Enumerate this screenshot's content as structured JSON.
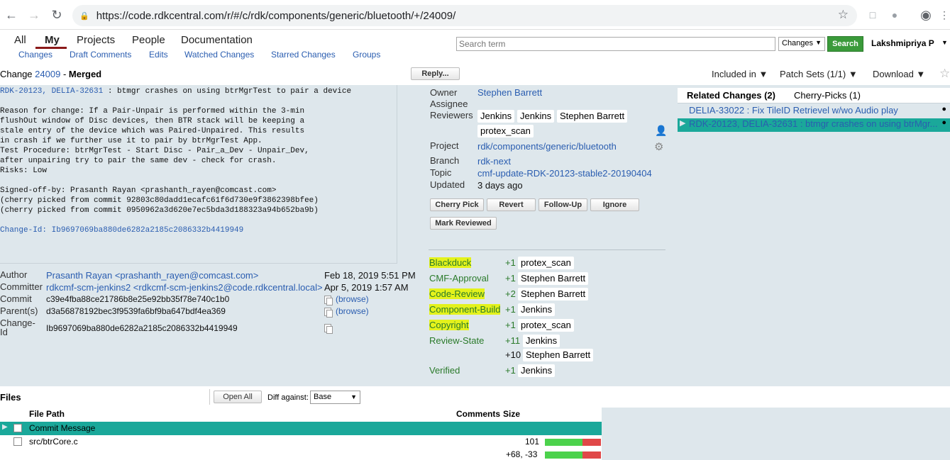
{
  "browser": {
    "url": "https://code.rdkcentral.com/r/#/c/rdk/components/generic/bluetooth/+/24009/"
  },
  "topmenu": {
    "items": [
      "All",
      "My",
      "Projects",
      "People",
      "Documentation"
    ],
    "subitems": [
      "Changes",
      "Draft Comments",
      "Edits",
      "Watched Changes",
      "Starred Changes",
      "Groups"
    ],
    "search_placeholder": "Search term",
    "search_scope": "Changes",
    "search_button": "Search",
    "user": "Lakshmipriya P"
  },
  "change": {
    "label": "Change",
    "number": "24009",
    "sep": " - ",
    "status": "Merged",
    "reply": "Reply...",
    "included_in": "Included in ▼",
    "patch_sets": "Patch Sets (1/1) ▼",
    "download": "Download ▼"
  },
  "commit_message": {
    "subject_links": "RDK-20123, DELIA-32631",
    "subject_rest": " : btmgr crashes on using btrMgrTest to pair a device",
    "body": "Reason for change: If a Pair-Unpair is performed within the 3-min\nflushOut window of Disc devices, then BTR stack will be keeping a\nstale entry of the device which was Paired-Unpaired. This results\nin crash if we further use it to pair by btrMgrTest App.\nTest Procedure: btrMgrTest - Start Disc - Pair_a_Dev - Unpair_Dev,\nafter unpairing try to pair the same dev - check for crash.\nRisks: Low\n\nSigned-off-by: Prasanth Rayan <prashanth_rayen@comcast.com>\n(cherry picked from commit 92803c80dadd1ecafc61f6d730e9f3862398bfee)\n(cherry picked from commit 0950962a3d620e7ec5bda3d188323a94b652ba9b)",
    "change_id_line": "Change-Id: Ib9697069ba880de6282a2185c2086332b4419949"
  },
  "info": {
    "owner_label": "Owner",
    "owner": "Stephen Barrett",
    "assignee_label": "Assignee",
    "reviewers_label": "Reviewers",
    "reviewers": [
      "Jenkins",
      "Jenkins",
      "Stephen Barrett",
      "protex_scan"
    ],
    "project_label": "Project",
    "project": "rdk/components/generic/bluetooth",
    "branch_label": "Branch",
    "branch": "rdk-next",
    "topic_label": "Topic",
    "topic": "cmf-update-RDK-20123-stable2-20190404",
    "updated_label": "Updated",
    "updated": "3 days ago"
  },
  "actions": [
    "Cherry Pick",
    "Revert",
    "Follow-Up",
    "Ignore",
    "Mark Reviewed"
  ],
  "labels": [
    {
      "name": "Blackduck",
      "score": "+1",
      "who": "protex_scan"
    },
    {
      "name": "CMF-Approval",
      "score": "+1",
      "who": "Stephen Barrett"
    },
    {
      "name": "Code-Review",
      "score": "+2",
      "who": "Stephen Barrett"
    },
    {
      "name": "Component-Build",
      "score": "+1",
      "who": "Jenkins"
    },
    {
      "name": "Copyright",
      "score": "+1",
      "who": "protex_scan"
    },
    {
      "name": "Review-State",
      "score": "+11",
      "who": "Jenkins"
    },
    {
      "name": "",
      "score": "+10",
      "who": "Stephen Barrett"
    },
    {
      "name": "Verified",
      "score": "+1",
      "who": "Jenkins"
    }
  ],
  "meta": {
    "author_label": "Author",
    "author": "Prasanth Rayan <prashanth_rayen@comcast.com>",
    "author_date": "Feb 18, 2019 5:51 PM",
    "committer_label": "Committer",
    "committer": "rdkcmf-scm-jenkins2 <rdkcmf-scm-jenkins2@code.rdkcentral.local>",
    "committer_date": "Apr 5, 2019 1:57 AM",
    "commit_label": "Commit",
    "commit": "c39e4fba88ce21786b8e25e92bb35f78e740c1b0",
    "parents_label": "Parent(s)",
    "parent": "d3a56878192bec3f9539fa6bf9ba647bdf4ea369",
    "changeid_label_1": "Change-",
    "changeid_label_2": "Id",
    "changeid": "Ib9697069ba880de6282a2185c2086332b4419949",
    "browse": "(browse)"
  },
  "related": {
    "tab_related": "Related Changes (2)",
    "tab_cherry": "Cherry-Picks (1)",
    "rows": [
      "DELIA-33022 : Fix TileID Retrievel w/wo Audio play",
      "RDK-20123, DELIA-32631 : btmgr crashes on using btrMgr..."
    ]
  },
  "files": {
    "title": "Files",
    "open_all": "Open All",
    "diff_against_label": "Diff against:",
    "diff_against": "Base",
    "col_path": "File Path",
    "col_comments": "Comments",
    "col_size": "Size",
    "rows": [
      {
        "path": "Commit Message",
        "size": ""
      },
      {
        "path": "src/btrCore.c",
        "size": "101"
      }
    ],
    "total": "+68, -33",
    "colors": {
      "added": "#4cd24c",
      "removed": "#e04848",
      "selected": "#1aa89a"
    }
  }
}
